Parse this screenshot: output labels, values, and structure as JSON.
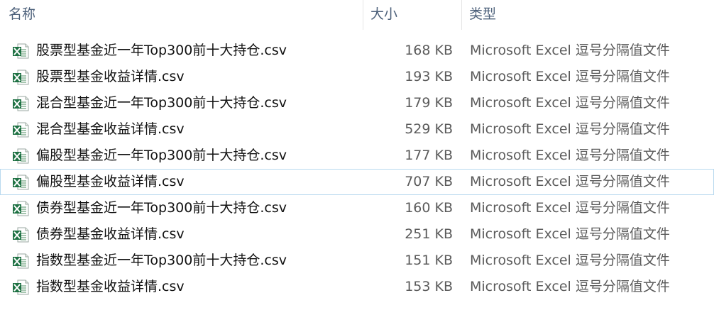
{
  "header": {
    "name_label": "名称",
    "size_label": "大小",
    "type_label": "类型",
    "sort_indicator": "^"
  },
  "colors": {
    "header_text": "#4c607a",
    "excel_green": "#1f7244",
    "focus_border": "#b8d9ef"
  },
  "files": [
    {
      "name": "股票型基金近一年Top300前十大持仓.csv",
      "size": "168 KB",
      "type": "Microsoft Excel 逗号分隔值文件",
      "icon": "excel-csv-icon"
    },
    {
      "name": "股票型基金收益详情.csv",
      "size": "193 KB",
      "type": "Microsoft Excel 逗号分隔值文件",
      "icon": "excel-csv-icon"
    },
    {
      "name": "混合型基金近一年Top300前十大持仓.csv",
      "size": "179 KB",
      "type": "Microsoft Excel 逗号分隔值文件",
      "icon": "excel-csv-icon"
    },
    {
      "name": "混合型基金收益详情.csv",
      "size": "529 KB",
      "type": "Microsoft Excel 逗号分隔值文件",
      "icon": "excel-csv-icon"
    },
    {
      "name": "偏股型基金近一年Top300前十大持仓.csv",
      "size": "177 KB",
      "type": "Microsoft Excel 逗号分隔值文件",
      "icon": "excel-csv-icon"
    },
    {
      "name": "偏股型基金收益详情.csv",
      "size": "707 KB",
      "type": "Microsoft Excel 逗号分隔值文件",
      "icon": "excel-csv-icon"
    },
    {
      "name": "债券型基金近一年Top300前十大持仓.csv",
      "size": "160 KB",
      "type": "Microsoft Excel 逗号分隔值文件",
      "icon": "excel-csv-icon"
    },
    {
      "name": "债券型基金收益详情.csv",
      "size": "251 KB",
      "type": "Microsoft Excel 逗号分隔值文件",
      "icon": "excel-csv-icon"
    },
    {
      "name": "指数型基金近一年Top300前十大持仓.csv",
      "size": "151 KB",
      "type": "Microsoft Excel 逗号分隔值文件",
      "icon": "excel-csv-icon"
    },
    {
      "name": "指数型基金收益详情.csv",
      "size": "153 KB",
      "type": "Microsoft Excel 逗号分隔值文件",
      "icon": "excel-csv-icon"
    }
  ]
}
